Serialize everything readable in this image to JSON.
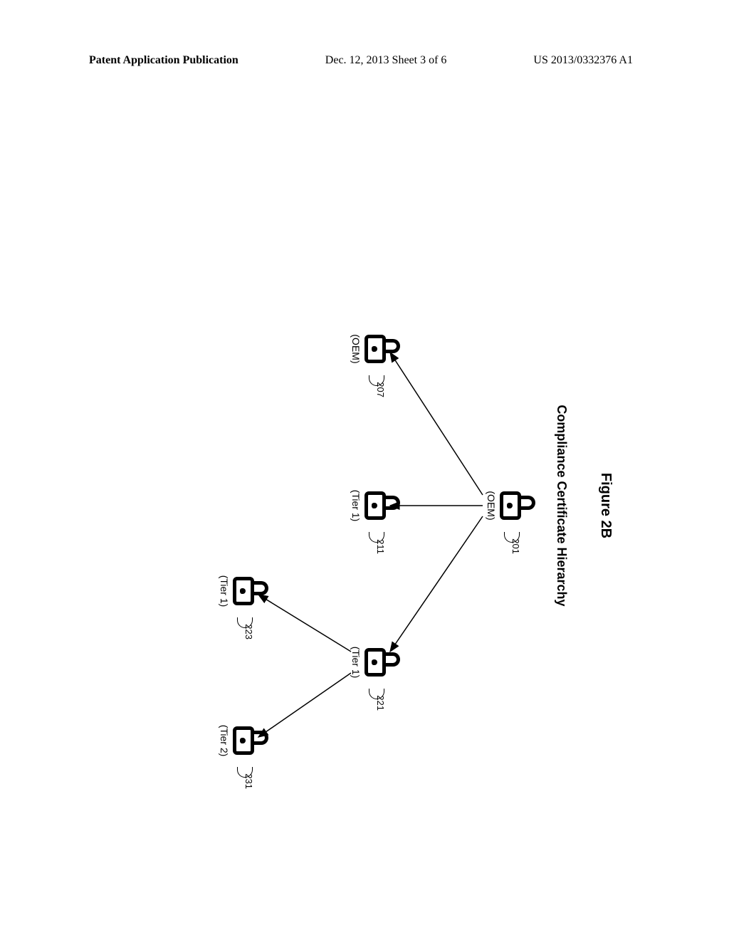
{
  "header": {
    "left": "Patent Application Publication",
    "center": "Dec. 12, 2013   Sheet 3 of 6",
    "right": "US 2013/0332376 A1"
  },
  "figure": {
    "label": "Figure 2B",
    "title": "Compliance Certificate Hierarchy"
  },
  "nodes": {
    "n201": {
      "ref": "201",
      "role": "(OEM)"
    },
    "n207": {
      "ref": "207",
      "role": "(OEM)"
    },
    "n211": {
      "ref": "211",
      "role": "(Tier 1)"
    },
    "n221": {
      "ref": "221",
      "role": "(Tier 1)"
    },
    "n223": {
      "ref": "223",
      "role": "(Tier 1)"
    },
    "n231": {
      "ref": "231",
      "role": "(Tier 2)"
    }
  }
}
